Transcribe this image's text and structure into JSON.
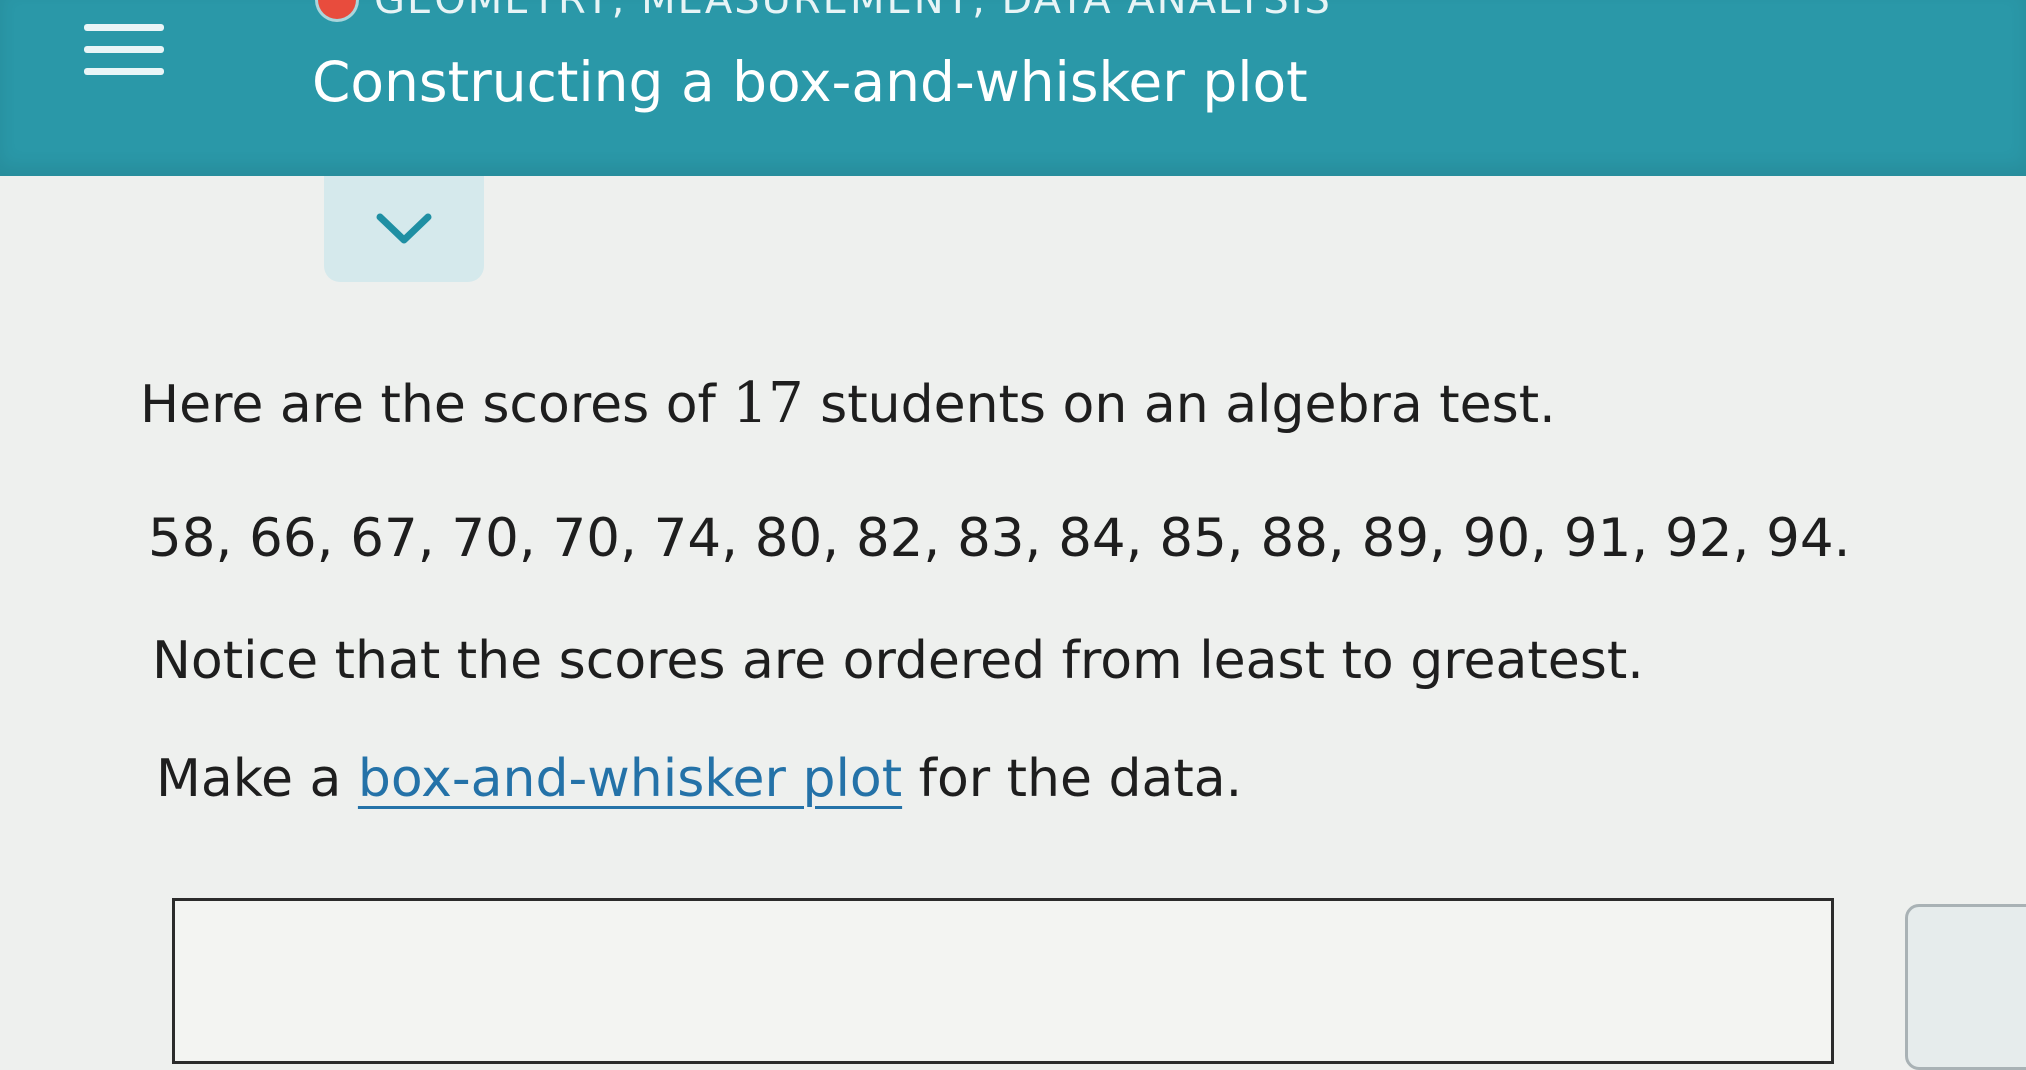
{
  "header": {
    "topic": "GEOMETRY, MEASUREMENT, DATA ANALYSIS",
    "title": "Constructing a box-and-whisker plot",
    "menu_icon": "hamburger-menu-icon",
    "status_dot_color": "#e84c3d",
    "background_color": "#2a98a8"
  },
  "collapse": {
    "icon": "chevron-down-icon"
  },
  "problem": {
    "intro_before": "Here are the scores of ",
    "count": "17",
    "intro_after": " students on an algebra test.",
    "scores_text": "58, 66, 67, 70, 70, 74, 80, 82, 83, 84, 85, 88, 89, 90, 91, 92, 94.",
    "notice": "Notice that the scores are ordered from least to greatest.",
    "instruction_before": "Make a ",
    "instruction_link": "box-and-whisker plot",
    "instruction_after": " for the data."
  }
}
